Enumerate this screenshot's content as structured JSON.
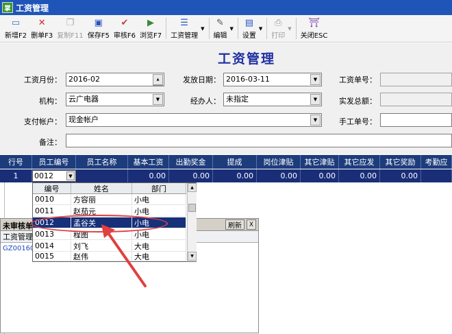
{
  "window": {
    "app_icon": "掌",
    "title": "工资管理"
  },
  "toolbar": {
    "buttons": [
      {
        "label": "新增F2",
        "icon": "new-doc-icon",
        "glyph": "📄"
      },
      {
        "label": "删单F3",
        "icon": "delete-x-icon",
        "glyph": "✖"
      },
      {
        "label": "复制F11",
        "icon": "copy-icon",
        "glyph": "⎘",
        "disabled": true
      },
      {
        "label": "保存F5",
        "icon": "save-disk-icon",
        "glyph": "💾"
      },
      {
        "label": "审核F6",
        "icon": "audit-check-icon",
        "glyph": "✔"
      },
      {
        "label": "浏览F7",
        "icon": "browse-icon",
        "glyph": "▶"
      }
    ],
    "salary_menu_label": "工资管理",
    "edit_label": "编辑",
    "settings_label": "设置",
    "print_label": "打印",
    "close_label": "关闭ESC",
    "colors": {
      "delete": "#d8242c",
      "save": "#2a55c0",
      "audit": "#3a8a3a"
    }
  },
  "form": {
    "heading": "工资管理",
    "month_label": "工资月份：",
    "month_value": "2016-02",
    "pay_date_label": "发放日期：",
    "pay_date_value": "2016-03-11",
    "salary_no_label": "工资单号：",
    "salary_no_value": "",
    "org_label": "机构：",
    "org_value": "云广电器",
    "handler_label": "经办人：",
    "handler_value": "未指定",
    "total_label": "实发总额：",
    "total_value": "",
    "account_label": "支付帐户：",
    "account_value": "现金帐户",
    "manual_no_label": "手工单号：",
    "manual_no_value": "",
    "remark_label": "备注：",
    "remark_value": ""
  },
  "grid": {
    "columns": [
      "行号",
      "员工编号",
      "员工名称",
      "基本工资",
      "出勤奖金",
      "提成",
      "岗位津贴",
      "其它津贴",
      "其它应发",
      "其它奖励",
      "考勤应"
    ],
    "row": {
      "line": "1",
      "emp_code": "0012",
      "emp_name": "",
      "values": [
        "0.00",
        "0.00",
        "0.00",
        "0.00",
        "0.00",
        "0.00",
        "0.00",
        ""
      ]
    }
  },
  "unreviewed_panel": {
    "title": "未审核单",
    "refresh_label": "刷新",
    "close_label": "X",
    "column": "工资管理",
    "cell": "GZ001603"
  },
  "dropdown": {
    "headers": [
      "编号",
      "姓名",
      "部门"
    ],
    "rows": [
      {
        "code": "0010",
        "name": "方容丽",
        "dept": "小电"
      },
      {
        "code": "0011",
        "name": "赵茄元",
        "dept": "小电"
      },
      {
        "code": "0012",
        "name": "孟谷关",
        "dept": "小电",
        "selected": true
      },
      {
        "code": "0013",
        "name": "程图",
        "dept": "小电"
      },
      {
        "code": "0014",
        "name": "刘飞",
        "dept": "大电"
      },
      {
        "code": "0015",
        "name": "赵伟",
        "dept": "大电"
      }
    ]
  },
  "annotation": {
    "color": "#e04040"
  }
}
